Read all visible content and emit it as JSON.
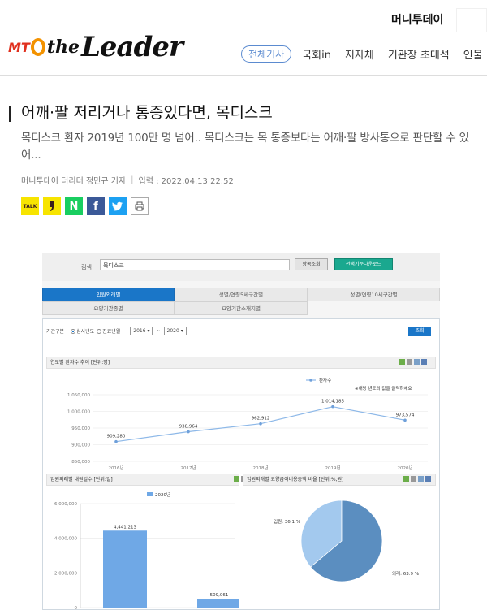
{
  "header": {
    "brand": "머니투데이",
    "logo_mt": "MT",
    "logo_the": "the",
    "logo_leader": "Leader",
    "nav": [
      "전체기사",
      "국회in",
      "지자체",
      "기관장 초대석",
      "인물"
    ]
  },
  "article": {
    "title": "어깨·팔 저리거나 통증있다면, 목디스크",
    "subtitle": "목디스크 환자 2019년 100만 명 넘어.. 목디스크는 목 통증보다는 어깨·팔 방사통으로 판단할 수 있어...",
    "byline": "머니투데이 더리더 정민규 기자",
    "date": "입력 : 2022.04.13 22:52"
  },
  "share": {
    "kakao": "TALK",
    "naver": "N",
    "facebook": "f",
    "print_icon": "print-icon"
  },
  "screenshot": {
    "search_label": "검색",
    "search_value": "목디스크",
    "btn_search": "항목조회",
    "btn_download": "선택기준다운로드",
    "tabs_row1": [
      "입원외래별",
      "성별/연령5세구간별",
      "성별/연령10세구간별"
    ],
    "tabs_row2": [
      "요양기관종별",
      "요양기관소재지별"
    ],
    "filter_label": "기간구분",
    "radio1": "심사년도",
    "radio2": "진료년월",
    "year_from": "2016",
    "year_tilde": "~",
    "year_to": "2020",
    "query_btn": "조회",
    "chart1_header": "연도별 환자수 추이 [단위:명]",
    "chart2_header": "입원외래별 내원일수 [단위:일]",
    "chart3_header": "입원외래별 요양급여비용총액 비율 [단위:%,원]",
    "legend1_note": "※해당 년도의 값을 클릭하세요"
  },
  "chart_data": [
    {
      "type": "line",
      "title": "연도별 환자수 추이 [단위:명]",
      "series": [
        {
          "name": "환자수",
          "values": [
            909280,
            938964,
            962912,
            1014185,
            973574
          ]
        }
      ],
      "categories": [
        "2016년",
        "2017년",
        "2018년",
        "2019년",
        "2020년"
      ],
      "value_labels": [
        "909,280",
        "938,964",
        "962,912",
        "1,014,185",
        "973,574"
      ],
      "yticks": [
        "1,050,000",
        "1,000,000",
        "950,000",
        "900,000",
        "850,000"
      ],
      "ylim": [
        850000,
        1050000
      ],
      "color": "#8db8e8"
    },
    {
      "type": "bar",
      "title": "입원외래별 내원일수 [단위:일]",
      "series": [
        {
          "name": "2020년",
          "values": [
            4441213,
            509061
          ]
        }
      ],
      "value_labels": [
        "4,441,213",
        "509,061"
      ],
      "yticks": [
        "6,000,000",
        "4,000,000",
        "2,000,000",
        "0"
      ],
      "ylim": [
        0,
        6000000
      ],
      "color": "#6fa8e6"
    },
    {
      "type": "pie",
      "title": "입원외래별 요양급여비용총액 비율 [단위:%,원]",
      "slices": [
        {
          "label": "입원",
          "value": 36.1,
          "text": "입원: 36.1 %",
          "color": "#a3c9ee"
        },
        {
          "label": "외래",
          "value": 63.9,
          "text": "외래: 63.9 %",
          "color": "#5b8ec0"
        }
      ]
    }
  ]
}
